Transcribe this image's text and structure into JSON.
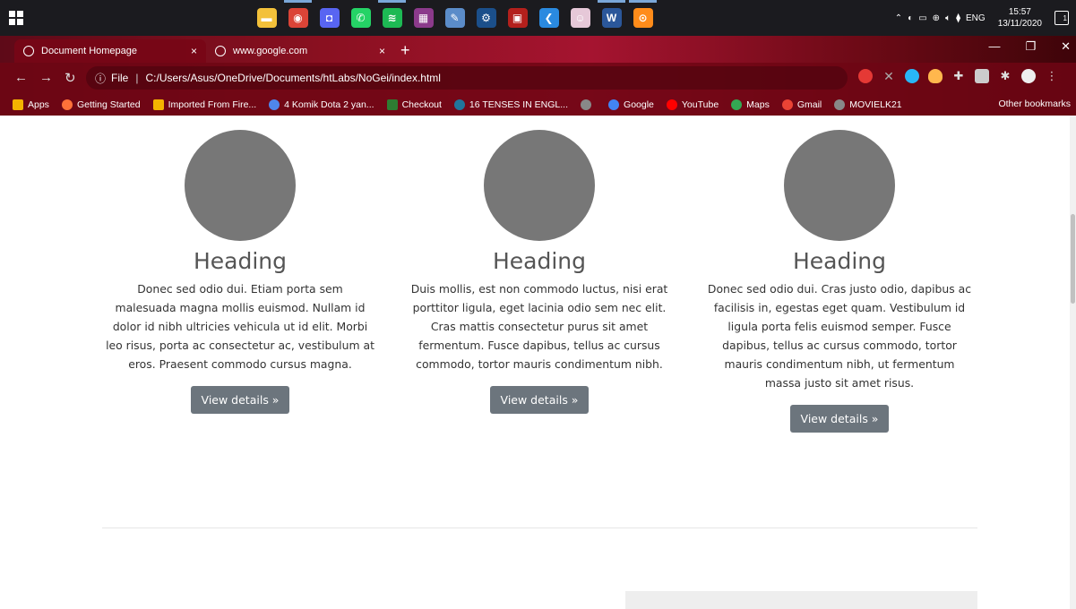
{
  "taskbar": {
    "apps": [
      {
        "icon": "file-explorer-icon",
        "color": "#f3c13a",
        "glyph": "▬",
        "active": false
      },
      {
        "icon": "chrome-icon",
        "color": "#db4437",
        "glyph": "◉",
        "active": true
      },
      {
        "icon": "discord-icon",
        "color": "#5865f2",
        "glyph": "◘",
        "active": false
      },
      {
        "icon": "whatsapp-icon",
        "color": "#25d366",
        "glyph": "✆",
        "active": false
      },
      {
        "icon": "spotify-icon",
        "color": "#1db954",
        "glyph": "≋",
        "active": true
      },
      {
        "icon": "winrar-icon",
        "color": "#8b3a8b",
        "glyph": "▦",
        "active": false
      },
      {
        "icon": "paint-icon",
        "color": "#5b8cc9",
        "glyph": "✎",
        "active": false
      },
      {
        "icon": "steam-icon",
        "color": "#1b4f8a",
        "glyph": "⚙",
        "active": false
      },
      {
        "icon": "dota-icon",
        "color": "#b3201c",
        "glyph": "▣",
        "active": false
      },
      {
        "icon": "vscode-icon",
        "color": "#2a8ae0",
        "glyph": "❮",
        "active": false
      },
      {
        "icon": "photo-icon",
        "color": "#e6c8d8",
        "glyph": "☺",
        "active": false
      },
      {
        "icon": "word-icon",
        "color": "#2b579a",
        "glyph": "W",
        "active": true
      },
      {
        "icon": "media-player-icon",
        "color": "#ff8c1a",
        "glyph": "⊙",
        "active": true
      }
    ],
    "language": "ENG",
    "time": "15:57",
    "date": "13/11/2020",
    "notification_count": "1"
  },
  "browser": {
    "tabs": [
      {
        "title": "Document Homepage",
        "close": "×"
      },
      {
        "title": "www.google.com",
        "close": "×"
      }
    ],
    "new_tab": "+",
    "address": {
      "scheme_label": "File",
      "url": "C:/Users/Asus/OneDrive/Documents/htLabs/NoGei/index.html"
    },
    "bookmarks": [
      {
        "label": "Apps",
        "color": "#f4b400"
      },
      {
        "label": "Getting Started",
        "color": "#ff7139"
      },
      {
        "label": "Imported From Fire...",
        "color": "#f4b400"
      },
      {
        "label": "4 Komik Dota 2 yan...",
        "color": "#4f86ec"
      },
      {
        "label": "Checkout",
        "color": "#2e7d32"
      },
      {
        "label": "16 TENSES IN ENGL...",
        "color": "#21759b"
      },
      {
        "label": "",
        "color": "#888888"
      },
      {
        "label": "Google",
        "color": "#4285f4"
      },
      {
        "label": "YouTube",
        "color": "#ff0000"
      },
      {
        "label": "Maps",
        "color": "#34a853"
      },
      {
        "label": "Gmail",
        "color": "#ea4335"
      },
      {
        "label": "MOVIELK21",
        "color": "#888888"
      }
    ],
    "other_bookmarks": "Other bookmarks"
  },
  "page": {
    "columns": [
      {
        "heading": "Heading",
        "text": "Donec sed odio dui. Etiam porta sem malesuada magna mollis euismod. Nullam id dolor id nibh ultricies vehicula ut id elit. Morbi leo risus, porta ac consectetur ac, vestibulum at eros. Praesent commodo cursus magna.",
        "button": "View details »"
      },
      {
        "heading": "Heading",
        "text": "Duis mollis, est non commodo luctus, nisi erat porttitor ligula, eget lacinia odio sem nec elit. Cras mattis consectetur purus sit amet fermentum. Fusce dapibus, tellus ac cursus commodo, tortor mauris condimentum nibh.",
        "button": "View details »"
      },
      {
        "heading": "Heading",
        "text": "Donec sed odio dui. Cras justo odio, dapibus ac facilisis in, egestas eget quam. Vestibulum id ligula porta felis euismod semper. Fusce dapibus, tellus ac cursus commodo, tortor mauris condimentum nibh, ut fermentum massa justo sit amet risus.",
        "button": "View details »"
      }
    ]
  }
}
